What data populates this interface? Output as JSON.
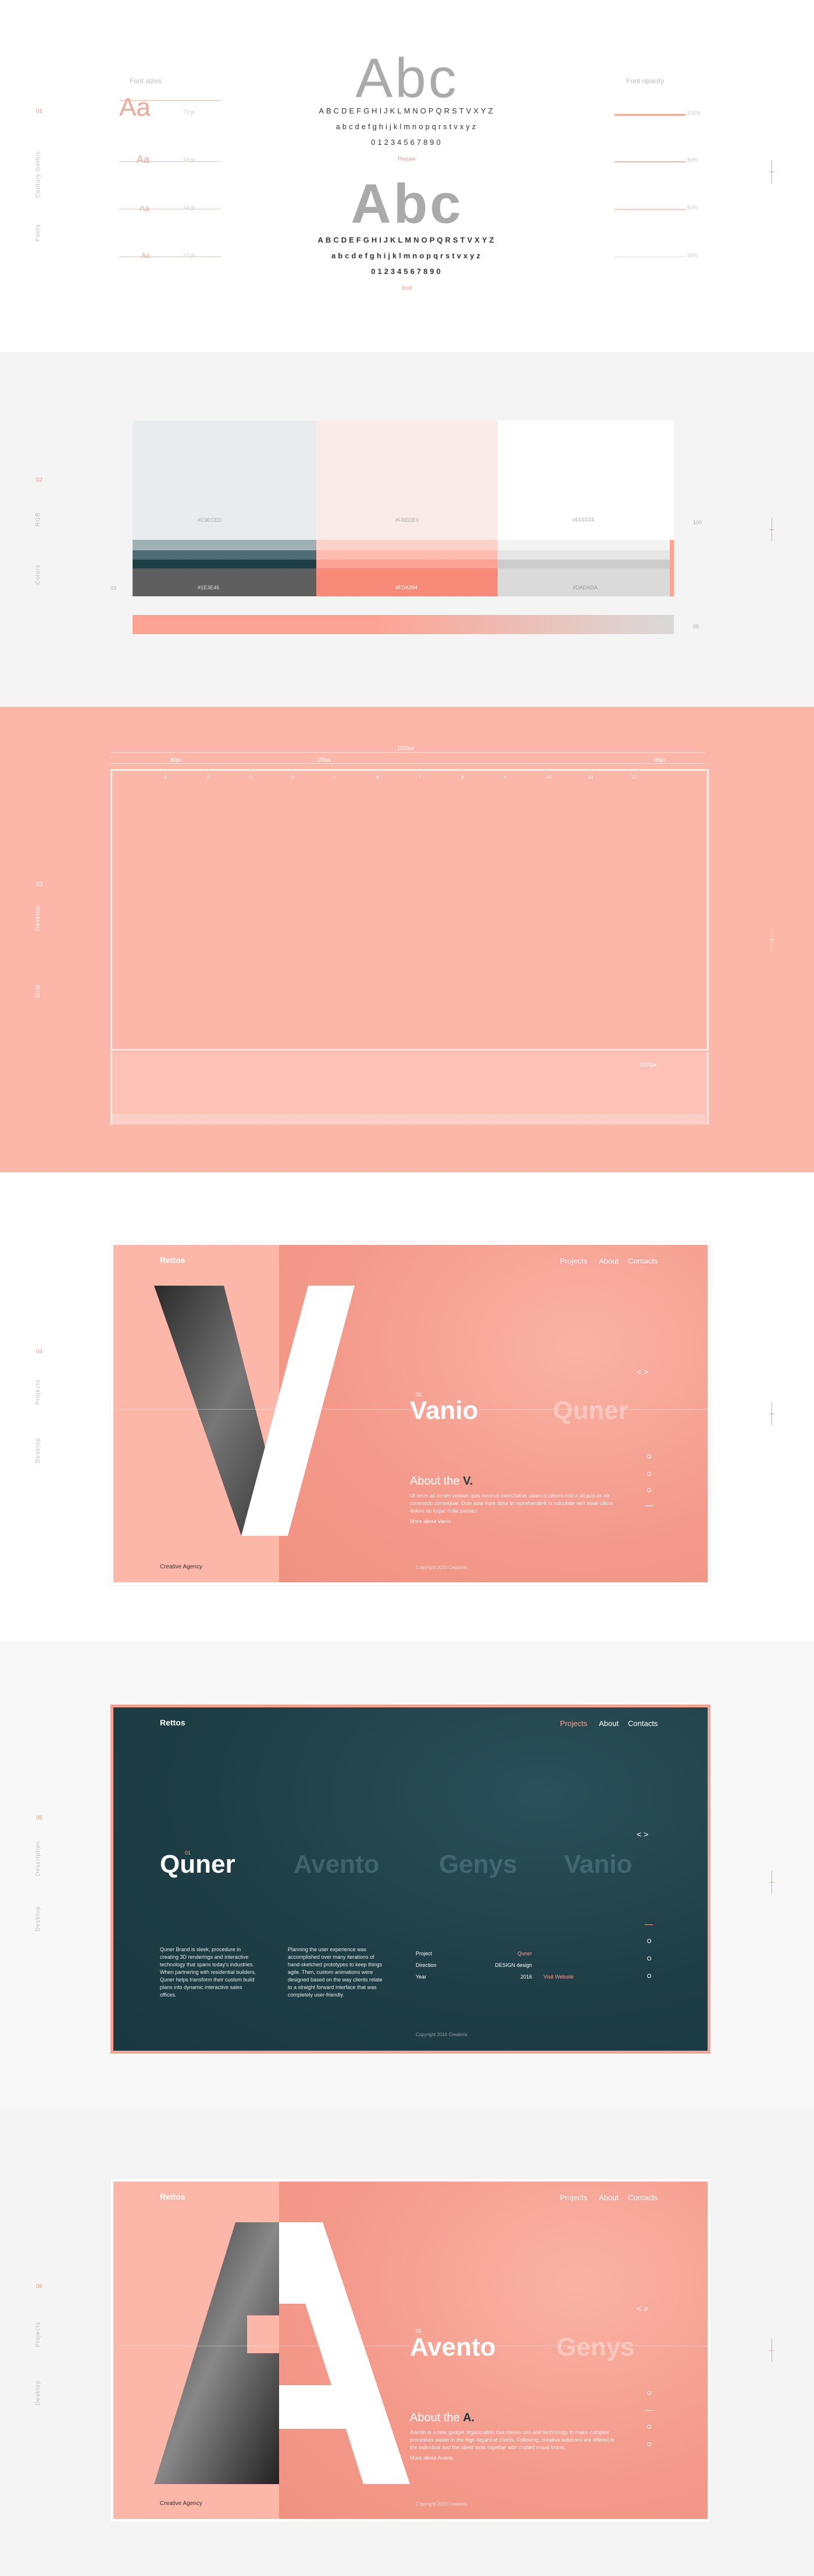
{
  "typography": {
    "font_sizes_label": "Font sizes",
    "font_opacity_label": "Font opacity",
    "sample_big": "Abc",
    "upper_chars": "ABCDEFGHIJKLMNOPQRSTVXYZ",
    "lower_chars": "abcdefghijklmnopqrstvxyz",
    "digits": "01234567890",
    "regular_label": "Regular",
    "bold_label": "Bold",
    "size_labels": [
      "Aa",
      "Aa",
      "Aa",
      "Aa"
    ],
    "size_values": [
      "72 pt",
      "18 pt",
      "14 pt",
      "12 pt"
    ],
    "opacity_values": [
      "100%",
      "80%",
      "60%",
      "40%"
    ],
    "side_label_a": "Century Gothic",
    "side_label_b": "Fonts",
    "section_number": "01"
  },
  "colors": {
    "side_label_a": "RGB",
    "side_label_b": "Colors",
    "section_number": "02",
    "swatches": [
      {
        "name": "#E9ECED",
        "hex": "#e9eced"
      },
      {
        "name": "#FBEDE9",
        "hex": "#f9ebe7"
      },
      {
        "name": "#FFFFFF",
        "hex": "#ffffff"
      }
    ],
    "bottom_names": [
      "#1E3E46",
      "#FDA394",
      "#DADADA"
    ],
    "left_mark": "03",
    "right_mark_top": "100",
    "right_mark_bottom": "05"
  },
  "grid": {
    "side_label_a": "Grid",
    "side_label_b": "Desktop",
    "section_number": "03",
    "width_label": "1920px",
    "margin_label": "80px",
    "col_label": "100px",
    "gutter_label": "30px",
    "right_label": "80px",
    "bottom_label": "1920px",
    "col_numbers": [
      "1",
      "2",
      "3",
      "4",
      "5",
      "6",
      "7",
      "8",
      "9",
      "10",
      "11",
      "12"
    ]
  },
  "mockup1": {
    "brand": "Rettos",
    "nav": [
      "Projects",
      "About",
      "Contacts"
    ],
    "letter": "V",
    "active_word": "Vanio",
    "active_index": "01",
    "next_word": "Quner",
    "about_title": "About the",
    "about_letter": "V.",
    "about_text": "Ut enim ad minim veniam quis nostrud exercitation ullamco laboris nisi ut aliquip ex ea commodo consequat. Duis aute irure dolor in reprehenderit in voluptate velit esse cillum dolore eu fugiat nulla pariatur.",
    "more_link": "More about Vanio",
    "footer_left": "Creative Agency",
    "footer_copy": "Copyright 2016 Creatorix",
    "arrows": "< >",
    "side_label_a": "Projects",
    "side_label_b": "Desktop",
    "section_number": "04"
  },
  "mockup2": {
    "brand": "Rettos",
    "nav": [
      "Projects",
      "About",
      "Contacts"
    ],
    "active_index": "01",
    "words": [
      "Quner",
      "Avento",
      "Genys",
      "Vanio"
    ],
    "col1_text": "Quner Brand is sleek, procedure in creating 3D renderings and interactive technology that spans today's industries. When partnering with residential builders, Quner helps transform their custom build plans into dynamic interactive sales offices.",
    "col2_text": "Planning the user experience was accomplished over many iterations of hand-sketched prototypes to keep things agile. Then, custom animations were designed based on the way clients relate to a straight forward interface that was completely user-friendly.",
    "details": [
      {
        "label": "Project",
        "value": "Quner"
      },
      {
        "label": "Direction",
        "value": "DESIGN design"
      },
      {
        "label": "Year",
        "value": "2016"
      }
    ],
    "visit_link": "Visit Website",
    "footer_copy": "Copyright 2016 Creatorix",
    "arrows": "< >",
    "side_label_a": "Description",
    "side_label_b": "Desktop",
    "section_number": "05"
  },
  "mockup3": {
    "brand": "Rettos",
    "nav": [
      "Projects",
      "About",
      "Contacts"
    ],
    "letter": "A",
    "active_word": "Avento",
    "active_index": "01",
    "next_word": "Genys",
    "about_title": "About the",
    "about_letter": "A.",
    "about_text": "Avento is a new gadget organization that makes use and technology to make complex processes easier in the high regard of clients. Following, creative solutions are offered to the individual and the latest tools together with crafted visual brand.",
    "more_link": "More about Avento",
    "footer_left": "Creative Agency",
    "footer_copy": "Copyright 2016 Creatorix",
    "arrows": "< >",
    "side_label_a": "Projects",
    "side_label_b": "Desktop",
    "section_number": "06"
  },
  "palette": {
    "accent": "#fda394",
    "salmon": "#f6a191",
    "teal": "#1e3e46"
  }
}
